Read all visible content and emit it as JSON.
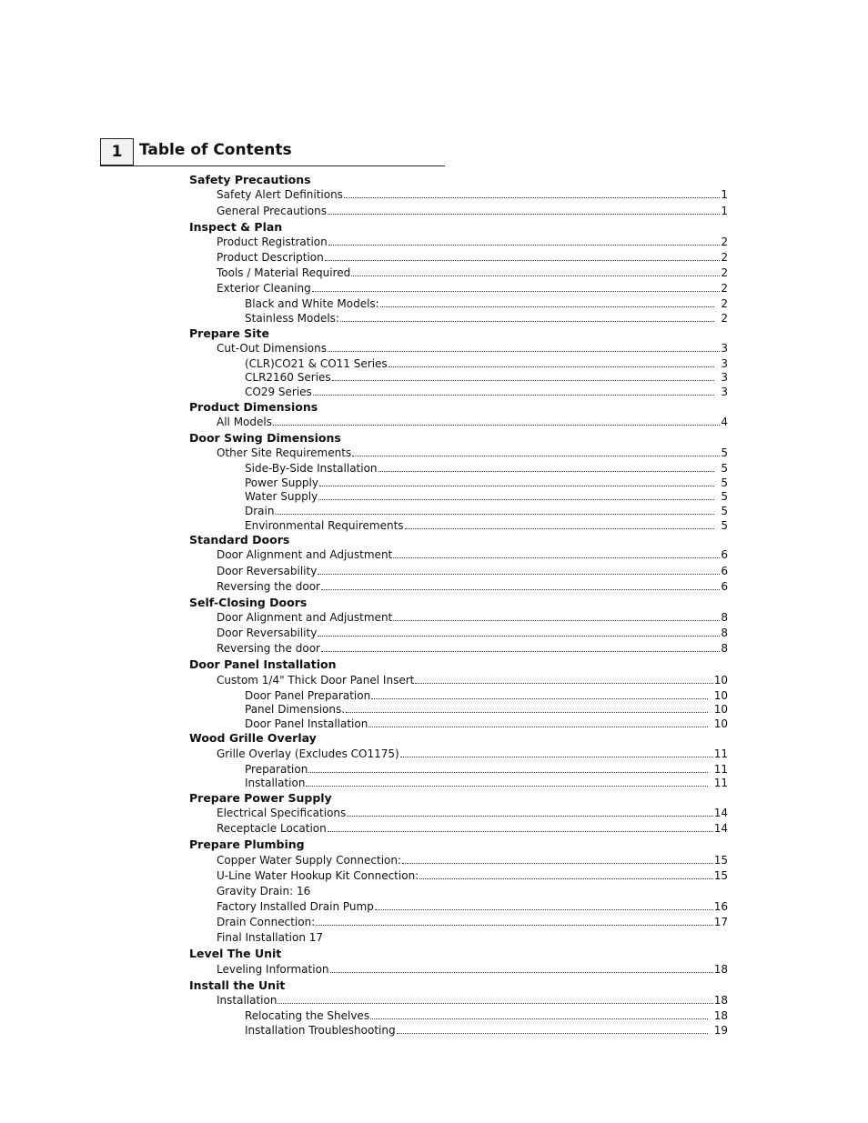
{
  "chapter": {
    "number": "1",
    "title": "Table of Contents"
  },
  "toc": [
    {
      "level": 0,
      "label": "Safety Precautions",
      "page": ""
    },
    {
      "level": 1,
      "label": "Safety Alert Definitions",
      "page": "1"
    },
    {
      "level": 1,
      "label": "General Precautions",
      "page": "1"
    },
    {
      "level": 0,
      "label": "Inspect & Plan",
      "page": ""
    },
    {
      "level": 1,
      "label": "Product Registration",
      "page": "2"
    },
    {
      "level": 1,
      "label": "Product Description",
      "page": "2"
    },
    {
      "level": 1,
      "label": "Tools / Material Required",
      "page": "2"
    },
    {
      "level": 1,
      "label": "Exterior Cleaning",
      "page": "2"
    },
    {
      "level": 2,
      "label": "Black and White Models:",
      "page": "2"
    },
    {
      "level": 2,
      "label": "Stainless Models:",
      "page": "2"
    },
    {
      "level": 0,
      "label": "Prepare Site",
      "page": ""
    },
    {
      "level": 1,
      "label": "Cut-Out Dimensions",
      "page": "3"
    },
    {
      "level": 2,
      "label": "(CLR)CO21 & CO11 Series",
      "page": "3"
    },
    {
      "level": 2,
      "label": "CLR2160 Series",
      "page": "3"
    },
    {
      "level": 2,
      "label": "CO29 Series",
      "page": "3"
    },
    {
      "level": 0,
      "label": "Product Dimensions",
      "page": ""
    },
    {
      "level": 1,
      "label": "All Models",
      "page": "4"
    },
    {
      "level": 0,
      "label": "Door Swing Dimensions",
      "page": ""
    },
    {
      "level": 1,
      "label": "Other Site Requirements",
      "page": "5"
    },
    {
      "level": 2,
      "label": "Side-By-Side Installation",
      "page": "5"
    },
    {
      "level": 2,
      "label": "Power Supply",
      "page": "5"
    },
    {
      "level": 2,
      "label": "Water Supply",
      "page": "5"
    },
    {
      "level": 2,
      "label": "Drain",
      "page": "5"
    },
    {
      "level": 2,
      "label": "Environmental Requirements",
      "page": "5"
    },
    {
      "level": 0,
      "label": "Standard Doors",
      "page": ""
    },
    {
      "level": 1,
      "label": "Door Alignment and Adjustment",
      "page": "6"
    },
    {
      "level": 1,
      "label": "Door Reversability",
      "page": "6"
    },
    {
      "level": 1,
      "label": "Reversing the door",
      "page": "6"
    },
    {
      "level": 0,
      "label": "Self-Closing Doors",
      "page": ""
    },
    {
      "level": 1,
      "label": "Door Alignment and Adjustment",
      "page": "8"
    },
    {
      "level": 1,
      "label": "Door Reversability",
      "page": "8"
    },
    {
      "level": 1,
      "label": "Reversing the door",
      "page": "8"
    },
    {
      "level": 0,
      "label": "Door Panel Installation",
      "page": ""
    },
    {
      "level": 1,
      "label": "Custom 1/4\" Thick Door Panel Insert",
      "page": "10"
    },
    {
      "level": 2,
      "label": "Door Panel Preparation",
      "page": "10"
    },
    {
      "level": 2,
      "label": "Panel Dimensions.",
      "page": "10"
    },
    {
      "level": 2,
      "label": "Door Panel Installation",
      "page": "10"
    },
    {
      "level": 0,
      "label": "Wood Grille Overlay",
      "page": ""
    },
    {
      "level": 1,
      "label": "Grille Overlay (Excludes CO1175)",
      "page": "11"
    },
    {
      "level": 2,
      "label": "Preparation",
      "page": "11"
    },
    {
      "level": 2,
      "label": "Installation",
      "page": "11"
    },
    {
      "level": 0,
      "label": "Prepare Power Supply",
      "page": ""
    },
    {
      "level": 1,
      "label": "Electrical Specifications",
      "page": "14"
    },
    {
      "level": 1,
      "label": "Receptacle Location",
      "page": "14"
    },
    {
      "level": 0,
      "label": "Prepare Plumbing",
      "page": ""
    },
    {
      "level": 1,
      "label": "Copper Water Supply Connection:",
      "page": "15"
    },
    {
      "level": 1,
      "label": "U-Line Water Hookup Kit Connection:",
      "page": "15"
    },
    {
      "level": 1,
      "label": "Gravity Drain: 16",
      "page": "",
      "plain": true
    },
    {
      "level": 1,
      "label": "Factory Installed Drain Pump",
      "page": "16"
    },
    {
      "level": 1,
      "label": "Drain Connection:",
      "page": "17"
    },
    {
      "level": 1,
      "label": "Final Installation 17",
      "page": "",
      "plain": true
    },
    {
      "level": 0,
      "label": "Level The Unit",
      "page": ""
    },
    {
      "level": 1,
      "label": "Leveling Information",
      "page": "18"
    },
    {
      "level": 0,
      "label": "Install the Unit",
      "page": ""
    },
    {
      "level": 1,
      "label": "Installation",
      "page": "18"
    },
    {
      "level": 2,
      "label": "Relocating the Shelves",
      "page": "18"
    },
    {
      "level": 2,
      "label": "Installation Troubleshooting",
      "page": "19"
    }
  ]
}
